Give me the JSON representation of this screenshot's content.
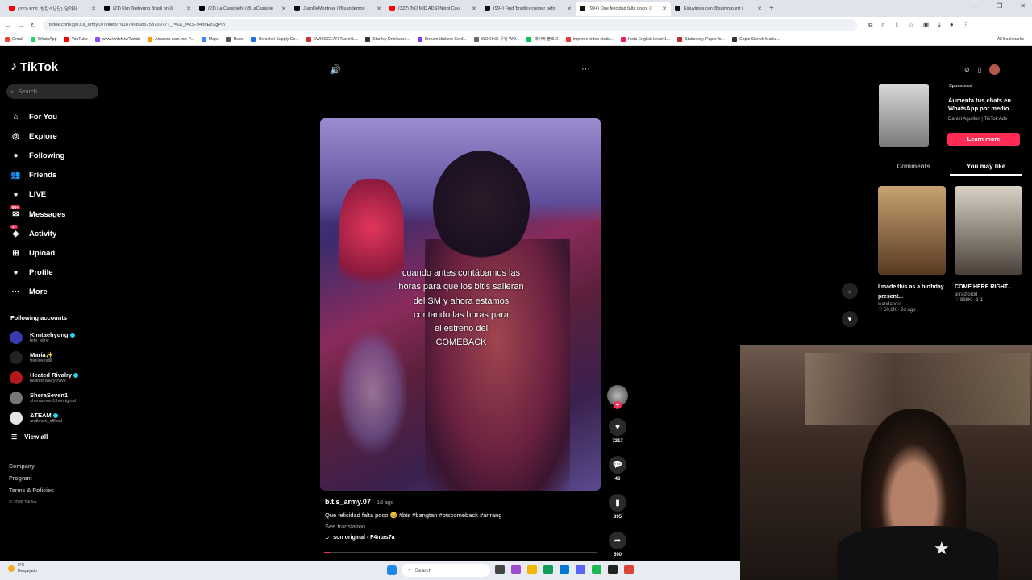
{
  "browser": {
    "tabs": [
      {
        "title": "(322) BTS (방탄소년단) '달려라",
        "color": "#ff0000"
      },
      {
        "title": "(21) Kim Taehyung Brasil on X:",
        "color": "#000000"
      },
      {
        "title": "(21) La Cassiojefe (@LaCassioje",
        "color": "#000000"
      },
      {
        "title": "JuanDeMontreal (@juandemon",
        "color": "#111111"
      },
      {
        "title": "(322) [NO MID ADS] Night Cou",
        "color": "#ff0000"
      },
      {
        "title": "(99+) Find 'bradley cooper befo",
        "color": "#111111"
      },
      {
        "title": "(99+) Que felicidad falta poco 🐰",
        "color": "#111111"
      },
      {
        "title": "Estuvimos con @susymouriz j",
        "color": "#111111"
      }
    ],
    "active_tab_index": 6,
    "new_tab": "+",
    "url": "tiktok.com/@b.t.s_army.07/video/7618749858575870977?_r=1&_t=ZS-94pnEzXgPih",
    "bookmarks": [
      "Gmail",
      "WhatsApp",
      "YouTube",
      "www.twitch.tv/Twitch",
      "Amazon.com.mx: P...",
      "Maps",
      "News",
      "Herschel Supply Co...",
      "SWISSGEAR Travel L...",
      "Stanley Drinkware...",
      "StreamStickers Conf...",
      "WOOING 우잉 WO...",
      "데이버 블로그",
      "Improve video statis...",
      "Insta English Level 1...",
      "Stationery, Paper fo...",
      "Copic Sketch Marke..."
    ],
    "all_bookmarks": "All Bookmarks"
  },
  "sidebar": {
    "logo": "TikTok",
    "search_placeholder": "Search",
    "menu": [
      {
        "label": "For You",
        "icon": "home-icon",
        "glyph": "⌂"
      },
      {
        "label": "Explore",
        "icon": "compass-icon",
        "glyph": "◎"
      },
      {
        "label": "Following",
        "icon": "following-icon",
        "glyph": "●"
      },
      {
        "label": "Friends",
        "icon": "friends-icon",
        "glyph": "👥"
      },
      {
        "label": "LIVE",
        "icon": "live-icon",
        "glyph": "●"
      },
      {
        "label": "Messages",
        "icon": "messages-icon",
        "glyph": "✉",
        "badge": "99+"
      },
      {
        "label": "Activity",
        "icon": "activity-icon",
        "glyph": "◈",
        "badge": "47"
      },
      {
        "label": "Upload",
        "icon": "upload-icon",
        "glyph": "⊞"
      },
      {
        "label": "Profile",
        "icon": "profile-icon",
        "glyph": "●"
      },
      {
        "label": "More",
        "icon": "more-icon",
        "glyph": "···"
      }
    ],
    "following_header": "Following accounts",
    "accounts": [
      {
        "name": "Kimtaehyung",
        "handle": "tete_kimv",
        "verified": true,
        "color": "#3b3bb0"
      },
      {
        "name": "María✨",
        "handle": "freelovestill",
        "verified": false,
        "color": "#222222"
      },
      {
        "name": "Heated Rivalry",
        "handle": "heatedrivalrycrave",
        "verified": true,
        "color": "#b0191e"
      },
      {
        "name": "SheraSeven1",
        "handle": "sheraseven1theoriginal",
        "verified": false,
        "color": "#777777"
      },
      {
        "name": "&TEAM",
        "handle": "andteam_official",
        "verified": true,
        "color": "#e6e6e6"
      }
    ],
    "view_all": "View all",
    "footer": [
      "Company",
      "Program",
      "Terms & Policies"
    ],
    "copyright": "© 2026 TikTok"
  },
  "video": {
    "caption_lines": [
      "cuando antes contábamos las",
      "horas para que los bitis salieran",
      "del SM y ahora estamos",
      "contando las horas para",
      "el estreno del",
      "COMEBACK"
    ],
    "author": "b.t.s_army.07",
    "posted": "· 1d ago",
    "description": "Que felicidad falta poco 🥹 #bts #bangtan #btscomeback #arirang",
    "see_translation": "See translation",
    "sound": "son original - F4ntas7a",
    "progress": 0.02,
    "likes": "7217",
    "comments": "46",
    "saves": "395",
    "shares": "590"
  },
  "right_panel": {
    "ad_label": "Sponsored",
    "ad_text": "Aumenta tus chats en WhatsApp por medio...",
    "ad_by": "Daniel Aguillón | TikTok Ads",
    "learn_more": "Learn more",
    "tab_comments": "Comments",
    "tab_you_may_like": "You may like",
    "cards": [
      {
        "title": "I made this as a birthday present...",
        "user": "wandahour",
        "stats": "♡ 50.6K · 2d ago"
      },
      {
        "title": "COME HERE RIGHT...",
        "user": "aliradfordd",
        "stats": "♡ 898K · 1-1"
      }
    ]
  },
  "taskbar": {
    "temp": "8°C",
    "condition": "Despejado",
    "search": "Search"
  }
}
